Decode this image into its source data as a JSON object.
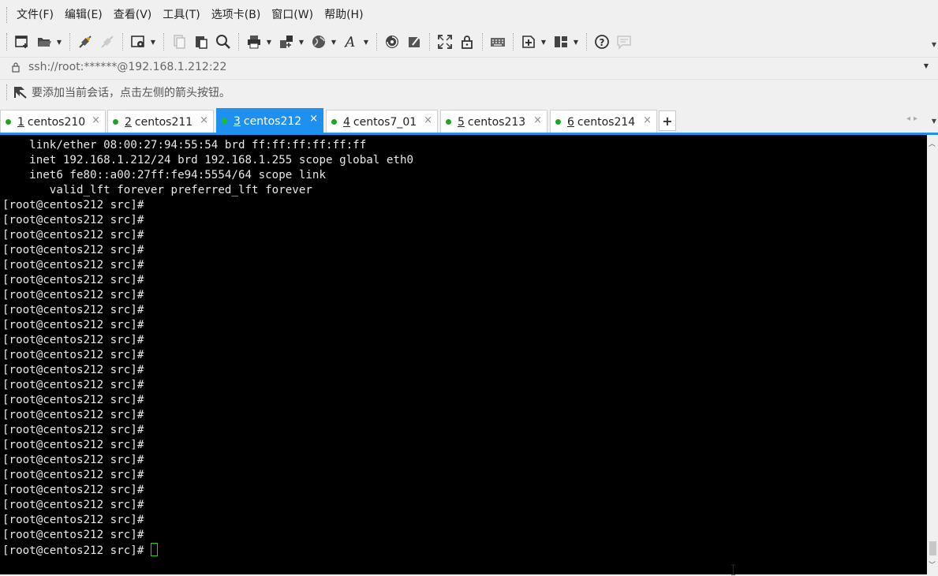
{
  "menu": [
    "文件(F)",
    "编辑(E)",
    "查看(V)",
    "工具(T)",
    "选项卡(B)",
    "窗口(W)",
    "帮助(H)"
  ],
  "toolbar": {
    "icons": [
      "new-session-icon",
      "open-folder-icon",
      "connect-icon",
      "disconnect-icon",
      "properties-icon",
      "copy-icon",
      "paste-icon",
      "find-icon",
      "print-icon",
      "transfer-icon",
      "globe-icon",
      "font-icon",
      "script-icon",
      "compose-icon",
      "fullscreen-icon",
      "lock-icon",
      "keyboard-icon",
      "new-tab-icon",
      "layout-icon",
      "help-icon",
      "chat-icon"
    ]
  },
  "address": {
    "text": "ssh://root:******@192.168.1.212:22"
  },
  "hint": {
    "text": "要添加当前会话，点击左侧的箭头按钮。"
  },
  "tabs": [
    {
      "num": "1",
      "label": "centos210",
      "active": false
    },
    {
      "num": "2",
      "label": "centos211",
      "active": false
    },
    {
      "num": "3",
      "label": "centos212",
      "active": true
    },
    {
      "num": "4",
      "label": "centos7_01",
      "active": false
    },
    {
      "num": "5",
      "label": "centos213",
      "active": false
    },
    {
      "num": "6",
      "label": "centos214",
      "active": false
    }
  ],
  "terminal": {
    "lines": [
      "    link/ether 08:00:27:94:55:54 brd ff:ff:ff:ff:ff:ff",
      "    inet 192.168.1.212/24 brd 192.168.1.255 scope global eth0",
      "    inet6 fe80::a00:27ff:fe94:5554/64 scope link",
      "       valid_lft forever preferred_lft forever",
      "[root@centos212 src]#",
      "[root@centos212 src]#",
      "[root@centos212 src]#",
      "[root@centos212 src]#",
      "[root@centos212 src]#",
      "[root@centos212 src]#",
      "[root@centos212 src]#",
      "[root@centos212 src]#",
      "[root@centos212 src]#",
      "[root@centos212 src]#",
      "[root@centos212 src]#",
      "[root@centos212 src]#",
      "[root@centos212 src]#",
      "[root@centos212 src]#",
      "[root@centos212 src]#",
      "[root@centos212 src]#",
      "[root@centos212 src]#",
      "[root@centos212 src]#",
      "[root@centos212 src]#",
      "[root@centos212 src]#",
      "[root@centos212 src]#",
      "[root@centos212 src]#",
      "[root@centos212 src]#"
    ],
    "prompt": "[root@centos212 src]# "
  },
  "colors": {
    "accent": "#1e90f0",
    "terminal_bg": "#000000",
    "terminal_fg": "#e8e8e8",
    "cursor": "#1fd61f",
    "status_dot": "#1ea61e"
  }
}
